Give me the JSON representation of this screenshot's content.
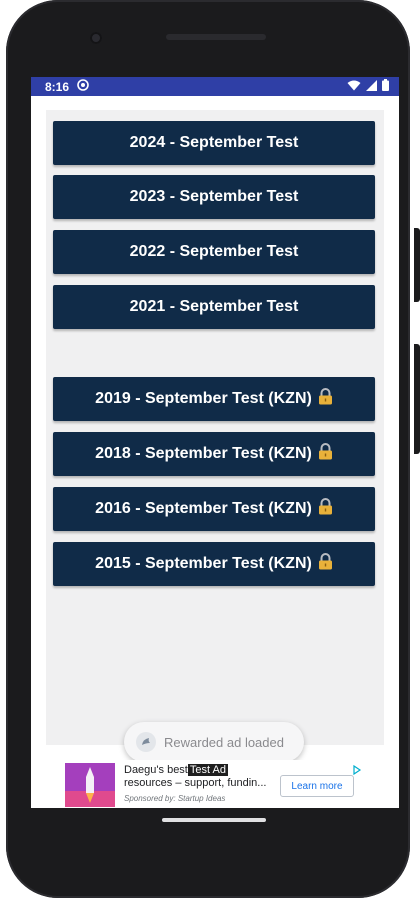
{
  "status_bar": {
    "time": "8:16"
  },
  "tests": [
    {
      "label": "2024 - September Test",
      "locked": false
    },
    {
      "label": "2023 - September Test",
      "locked": false
    },
    {
      "label": "2022 - September Test",
      "locked": false
    },
    {
      "label": "2021 - September Test",
      "locked": false
    },
    {
      "label": "2019 - September Test (KZN)",
      "locked": true
    },
    {
      "label": "2018 - September Test (KZN)",
      "locked": true
    },
    {
      "label": "2016 - September Test (KZN)",
      "locked": true
    },
    {
      "label": "2015 - September Test (KZN)",
      "locked": true
    }
  ],
  "toast": {
    "message": "Rewarded ad loaded"
  },
  "ad": {
    "headline_prefix": "Daegu's best",
    "test_label": "Test Ad",
    "headline_line2": "resources – support, fundin...",
    "sponsor": "Sponsored by: Startup Ideas",
    "cta": "Learn more"
  },
  "colors": {
    "status_bar": "#2f3fa6",
    "button_bg": "#102b48",
    "button_text": "#ffffff",
    "app_bg": "#f0f0f1",
    "lock": "#e8b13a"
  },
  "icons": {
    "status_left": [
      "app-notification-icon"
    ],
    "status_right": [
      "wifi-icon",
      "cell-signal-icon",
      "battery-icon"
    ],
    "lock": "lock-icon",
    "toast": "ad-icon"
  }
}
